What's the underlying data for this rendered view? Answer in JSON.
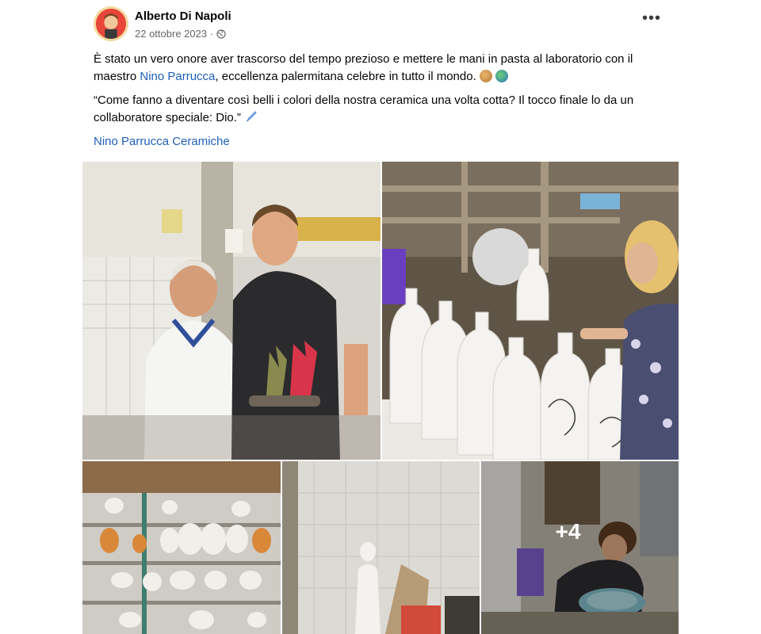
{
  "post": {
    "author": "Alberto Di Napoli",
    "date": "22 ottobre 2023 ·",
    "privacy_icon": "globe-icon",
    "more_icon": "more-options-icon",
    "more_label": "•••",
    "paragraph1_before": "È stato un vero onore aver trascorso del tempo prezioso e mettere le mani in pasta al laboratorio con il maestro ",
    "paragraph1_mention": "Nino Parrucca",
    "paragraph1_after": ", eccellenza palermitana celebre in tutto il mondo. ",
    "paragraph2": "“Come fanno a diventare così belli i colori della nostra ceramica una volta cotta? Il tocco finale lo da un collaboratore speciale: Dio.” ",
    "tagged_page": "Nino Parrucca Ceramiche"
  },
  "gallery": {
    "photo_count": 9,
    "extra_label": "+4"
  },
  "colors": {
    "link": "#1f5fb8",
    "meta_text": "#65676b"
  }
}
